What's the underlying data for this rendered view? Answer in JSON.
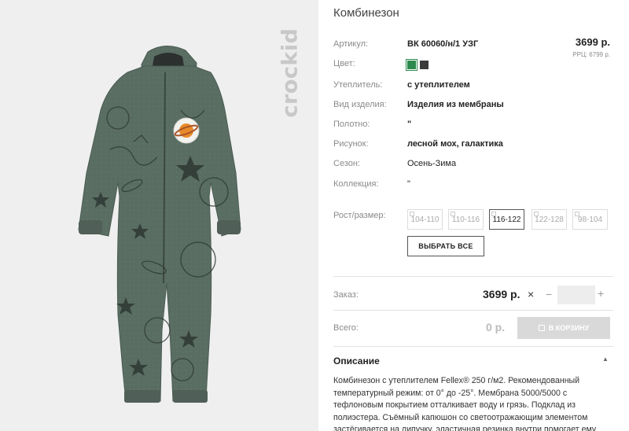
{
  "brand": {
    "logo_text": "crockid"
  },
  "product": {
    "title": "Комбинезон",
    "price": "3699 р.",
    "rrp": "РРЦ: 6799 р.",
    "attributes": [
      {
        "label": "Артикул:",
        "value": "ВК 60060/н/1 УЗГ"
      },
      {
        "label": "Цвет:",
        "value": ""
      },
      {
        "label": "Утеплитель:",
        "value": "с утеплителем"
      },
      {
        "label": "Вид изделия:",
        "value": "Изделия из мембраны"
      },
      {
        "label": "Полотно:",
        "value": "\""
      },
      {
        "label": "Рисунок:",
        "value": "лесной мох, галактика"
      },
      {
        "label": "Сезон:",
        "value": "Осень-Зима"
      },
      {
        "label": "Коллекция:",
        "value": "\""
      }
    ],
    "colors": [
      "#2d8a4e",
      "#3a3a3a"
    ],
    "size_label": "Рост/размер:",
    "sizes": [
      "104-110",
      "110-116",
      "116-122",
      "122-128",
      "98-104"
    ],
    "selected_size": "116-122",
    "select_all_label": "ВЫБРАТЬ ВСЕ"
  },
  "order": {
    "label": "Заказ:",
    "price": "3699 р.",
    "times": "×",
    "minus": "−",
    "plus": "+",
    "quantity": ""
  },
  "total": {
    "label": "Всего:",
    "price": "0 р.",
    "cart_label": "В КОРЗИНУ"
  },
  "description": {
    "heading": "Описание",
    "text": "Комбинезон с утеплителем Fellex® 250 г/м2. Рекомендованный температурный режим: от 0° до -25°. Мембрана 5000/5000 с тефлоновым покрытием отталкивает воду и грязь. Подклад из полиэстера. Съёмный капюшон со светоотражающим элементом застёгивается на липучку, эластичная резинка внутри помогает ему"
  }
}
